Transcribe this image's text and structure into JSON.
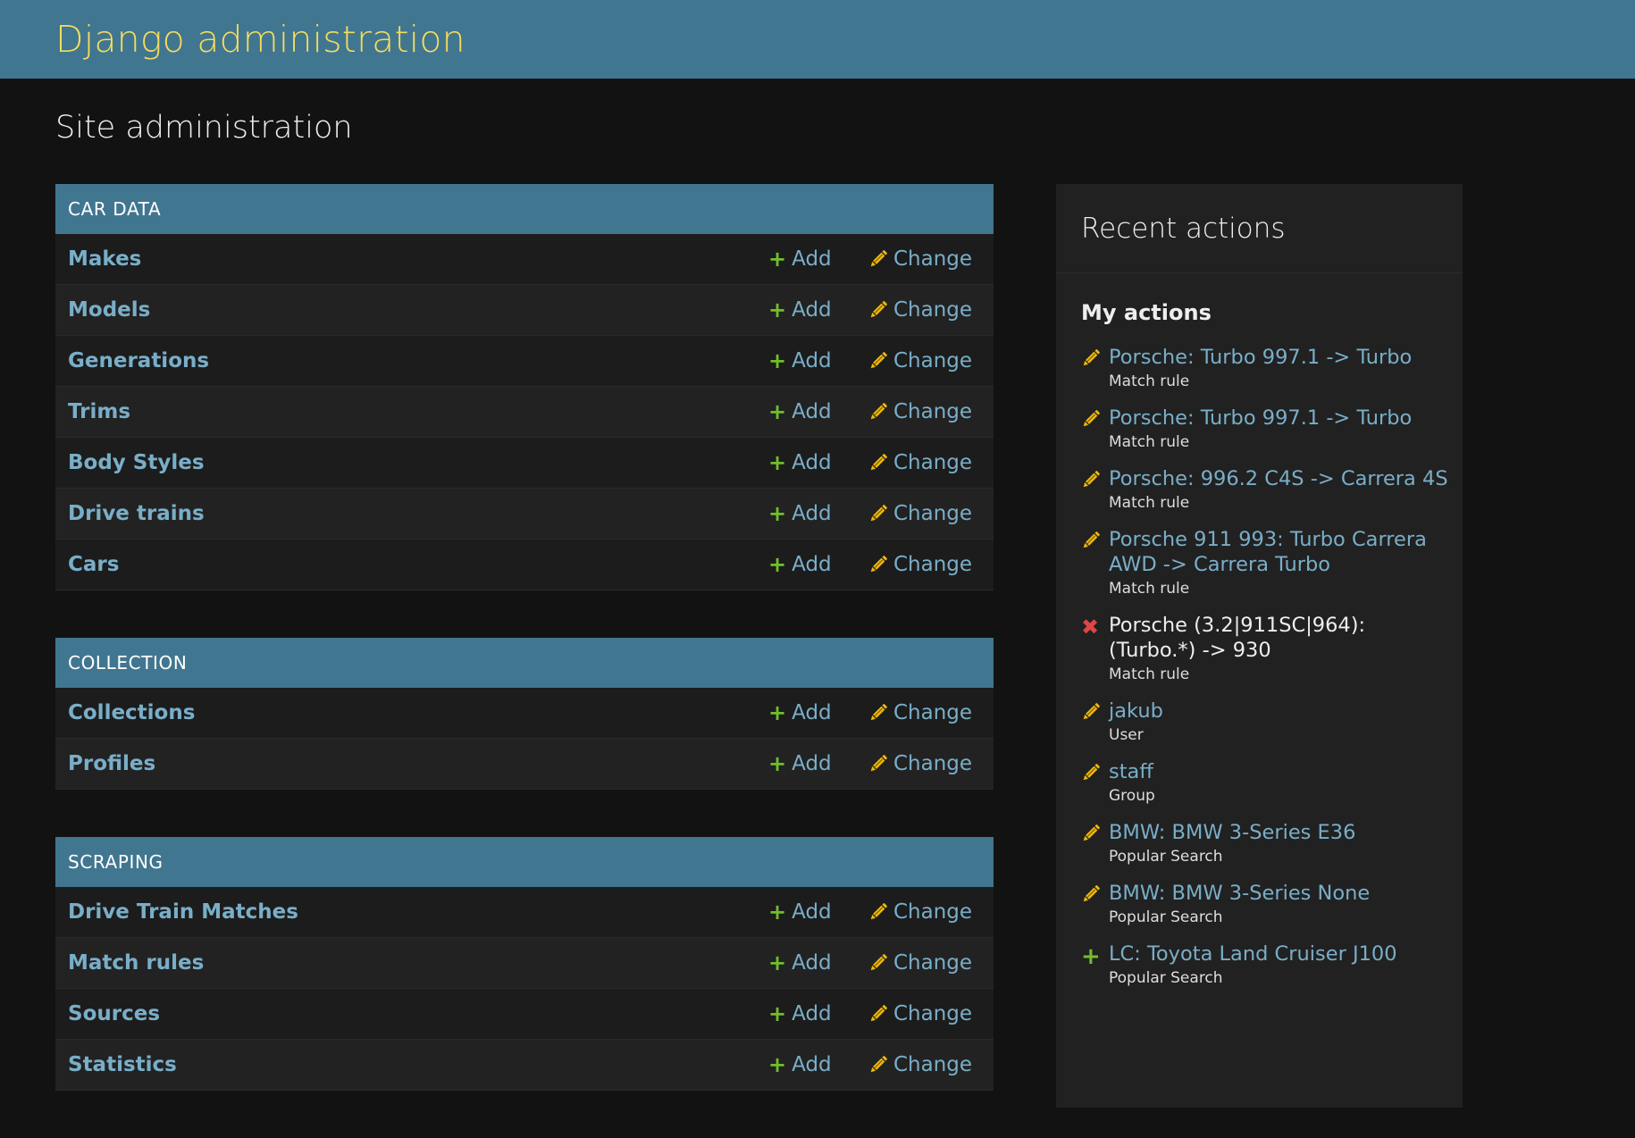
{
  "header": {
    "site_name": "Django administration"
  },
  "page": {
    "title": "Site administration"
  },
  "labels": {
    "add": "Add",
    "change": "Change"
  },
  "modules": [
    {
      "caption": "CAR DATA",
      "models": [
        {
          "name": "Makes"
        },
        {
          "name": "Models"
        },
        {
          "name": "Generations"
        },
        {
          "name": "Trims"
        },
        {
          "name": "Body Styles"
        },
        {
          "name": "Drive trains"
        },
        {
          "name": "Cars"
        }
      ]
    },
    {
      "caption": "COLLECTION",
      "models": [
        {
          "name": "Collections"
        },
        {
          "name": "Profiles"
        }
      ]
    },
    {
      "caption": "SCRAPING",
      "models": [
        {
          "name": "Drive Train Matches"
        },
        {
          "name": "Match rules"
        },
        {
          "name": "Sources"
        },
        {
          "name": "Statistics"
        }
      ]
    }
  ],
  "recent_actions": {
    "title": "Recent actions",
    "subtitle": "My actions",
    "items": [
      {
        "icon": "pencil-icon",
        "text": "Porsche: Turbo 997.1 -> Turbo",
        "type": "Match rule",
        "deleted": false
      },
      {
        "icon": "pencil-icon",
        "text": "Porsche: Turbo 997.1 -> Turbo",
        "type": "Match rule",
        "deleted": false
      },
      {
        "icon": "pencil-icon",
        "text": "Porsche: 996.2 C4S -> Carrera 4S",
        "type": "Match rule",
        "deleted": false
      },
      {
        "icon": "pencil-icon",
        "text": "Porsche 911 993: Turbo Carrera AWD -> Carrera Turbo",
        "type": "Match rule",
        "deleted": false
      },
      {
        "icon": "delete-icon",
        "text": "Porsche (3.2|911SC|964): (Turbo.*) -> 930",
        "type": "Match rule",
        "deleted": true
      },
      {
        "icon": "pencil-icon",
        "text": "jakub",
        "type": "User",
        "deleted": false
      },
      {
        "icon": "pencil-icon",
        "text": "staff",
        "type": "Group",
        "deleted": false
      },
      {
        "icon": "pencil-icon",
        "text": "BMW: BMW 3-Series E36",
        "type": "Popular Search",
        "deleted": false
      },
      {
        "icon": "pencil-icon",
        "text": "BMW: BMW 3-Series None",
        "type": "Popular Search",
        "deleted": false
      },
      {
        "icon": "plus-icon",
        "text": "LC: Toyota Land Cruiser J100",
        "type": "Popular Search",
        "deleted": false
      }
    ]
  },
  "colors": {
    "header_bg": "#417690",
    "site_name": "#f5dd5d",
    "link": "#79aec8",
    "add_icon": "#70bf2b",
    "change_icon": "#efb80b",
    "delete_icon": "#dd4646",
    "body_bg": "#121212"
  }
}
